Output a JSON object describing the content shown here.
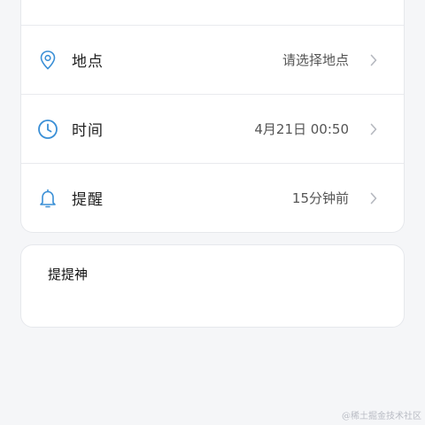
{
  "form": {
    "rows": [
      {
        "label": "地点",
        "value": "请选择地点",
        "icon": "location-pin-icon"
      },
      {
        "label": "时间",
        "value": "4月21日 00:50",
        "icon": "clock-icon"
      },
      {
        "label": "提醒",
        "value": "15分钟前",
        "icon": "bell-icon"
      }
    ]
  },
  "note": {
    "text": "提提神"
  },
  "watermark": "@稀土掘金技术社区",
  "colors": {
    "icon_blue": "#3a8fd6",
    "chevron": "#b5b8bf",
    "background": "#f5f6f8",
    "card": "#ffffff"
  }
}
